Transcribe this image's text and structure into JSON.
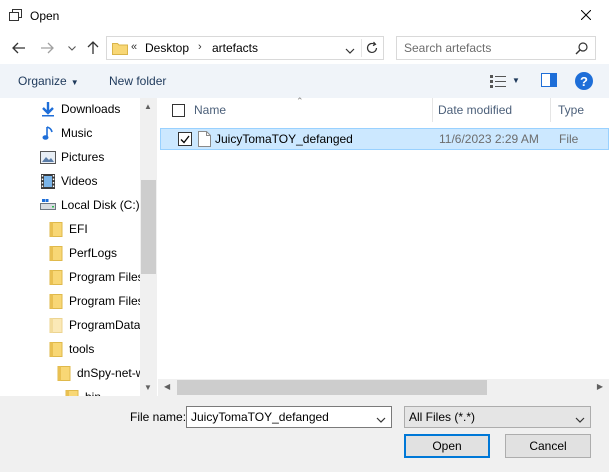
{
  "window": {
    "title": "Open",
    "app_icon": "open-dialog-icon",
    "close_icon": "close-icon"
  },
  "navigation": {
    "back_icon": "arrow-left-icon",
    "forward_icon": "arrow-right-icon",
    "recent_icon": "chevron-down-icon",
    "up_icon": "arrow-up-icon",
    "address": {
      "overflow": "«",
      "crumbs": [
        "Desktop",
        "artefacts"
      ],
      "separator": "›"
    },
    "refresh_icon": "refresh-icon",
    "search": {
      "placeholder": "Search artefacts",
      "icon": "search-icon"
    }
  },
  "toolbar": {
    "organize_label": "Organize",
    "new_folder_label": "New folder",
    "view_icon": "view-options-icon",
    "preview_pane_icon": "preview-pane-icon",
    "help_label": "?"
  },
  "nav_pane": {
    "items": [
      {
        "label": "Downloads",
        "icon": "download-arrow-icon"
      },
      {
        "label": "Music",
        "icon": "music-note-icon"
      },
      {
        "label": "Pictures",
        "icon": "pictures-icon"
      },
      {
        "label": "Videos",
        "icon": "videos-icon"
      },
      {
        "label": "Local Disk (C:)",
        "icon": "drive-icon"
      },
      {
        "label": "EFI",
        "icon": "folder-icon"
      },
      {
        "label": "PerfLogs",
        "icon": "folder-icon"
      },
      {
        "label": "Program Files",
        "icon": "folder-icon"
      },
      {
        "label": "Program Files",
        "icon": "folder-icon"
      },
      {
        "label": "ProgramData",
        "icon": "folder-icon"
      },
      {
        "label": "tools",
        "icon": "folder-icon"
      },
      {
        "label": "dnSpy-net-w",
        "icon": "folder-icon"
      },
      {
        "label": "bin",
        "icon": "folder-icon"
      }
    ]
  },
  "file_list": {
    "columns": [
      "Name",
      "Date modified",
      "Type"
    ],
    "rows": [
      {
        "name": "JuicyTomaTOY_defanged",
        "date_modified": "11/6/2023 2:29 AM",
        "type": "File",
        "checked": true,
        "selected": true
      }
    ]
  },
  "bottom": {
    "file_name_label": "File name:",
    "file_name_value": "JuicyTomaTOY_defanged",
    "file_type_value": "All Files (*.*)",
    "open_label": "Open",
    "cancel_label": "Cancel"
  },
  "colors": {
    "accent": "#0078d7",
    "selection_bg": "#cce8ff",
    "selection_border": "#99d1ff",
    "toolbar_text": "#1e395b",
    "folder_yellow": "#f8d775"
  }
}
